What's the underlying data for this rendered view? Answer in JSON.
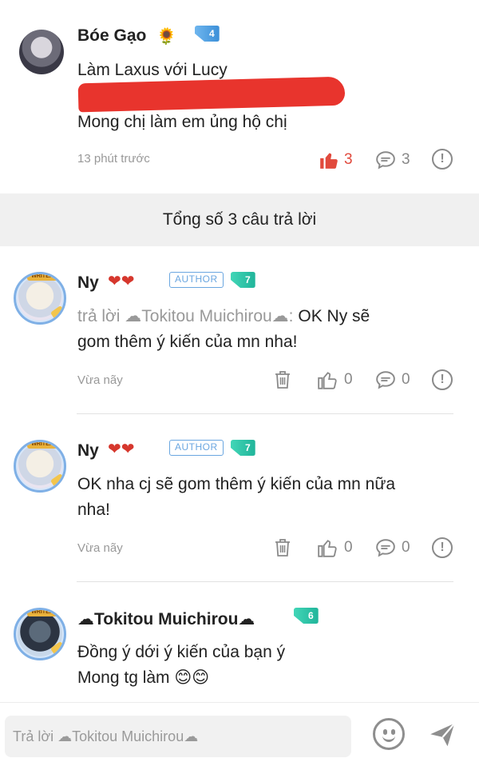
{
  "top_comment": {
    "author": "Bóe Gạo",
    "badge_icon": "sunflower",
    "level": "4",
    "line1": "Làm Laxus với Lucy",
    "line2": "Mong chị làm em ủng hộ chị",
    "time": "13 phút trước",
    "likes": "3",
    "replies": "3",
    "liked": true
  },
  "replies_header": "Tổng số 3 câu trả lời",
  "replies": [
    {
      "author": "Ny",
      "author_badge": "AUTHOR",
      "level": "7",
      "reply_prefix": "trả lời ☁Tokitou Muichirou☁:",
      "text_line1": " OK Ny sẽ",
      "text_line2": "gom thêm ý kiến của mn nha!",
      "time": "Vừa nãy",
      "likes": "0",
      "comments": "0"
    },
    {
      "author": "Ny",
      "author_badge": "AUTHOR",
      "level": "7",
      "text_line1": "OK nha cj sẽ gom thêm ý kiến của mn nữa",
      "text_line2": "nha!",
      "time": "Vừa nãy",
      "likes": "0",
      "comments": "0"
    },
    {
      "author": "☁Tokitou Muichirou☁",
      "level": "6",
      "text_line1": "Đồng ý dới ý kiến của bạn ý",
      "text_line2": "Mong tg làm 😊😊"
    }
  ],
  "composer": {
    "placeholder": "Trả lời ☁Tokitou Muichirou☁"
  },
  "colors": {
    "liked": "#e14a3d",
    "muted": "#8a8a8a",
    "redaction": "#e8342d",
    "level_blue": "#3b8fd8",
    "level_green": "#20b49a"
  }
}
